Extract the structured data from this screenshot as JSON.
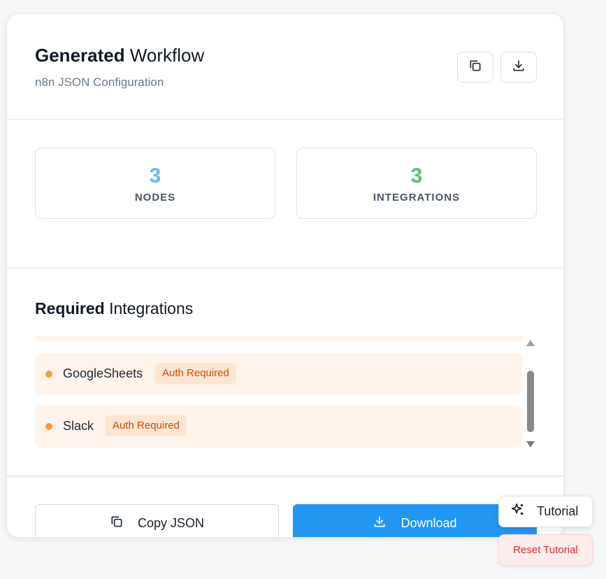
{
  "header": {
    "title_bold": "Generated",
    "title_rest": "Workflow",
    "subtitle": "n8n JSON Configuration"
  },
  "stats": [
    {
      "value": "3",
      "label": "NODES",
      "color": "#64b5f6"
    },
    {
      "value": "3",
      "label": "INTEGRATIONS",
      "color": "#5cb97a"
    }
  ],
  "integrations": {
    "title_bold": "Required",
    "title_rest": "Integrations",
    "items": [
      {
        "name": "GoogleSheets",
        "badge": "Auth Required"
      },
      {
        "name": "Slack",
        "badge": "Auth Required"
      }
    ]
  },
  "footer": {
    "copy_label": "Copy JSON",
    "download_label": "Download"
  },
  "floating": {
    "tutorial_label": "Tutorial",
    "reset_label": "Reset Tutorial"
  },
  "colors": {
    "accent": "#2196f3",
    "badge_bg": "#fde6cf",
    "badge_text": "#c2510c",
    "item_bg": "#fff4eb",
    "danger": "#d32f2f"
  }
}
